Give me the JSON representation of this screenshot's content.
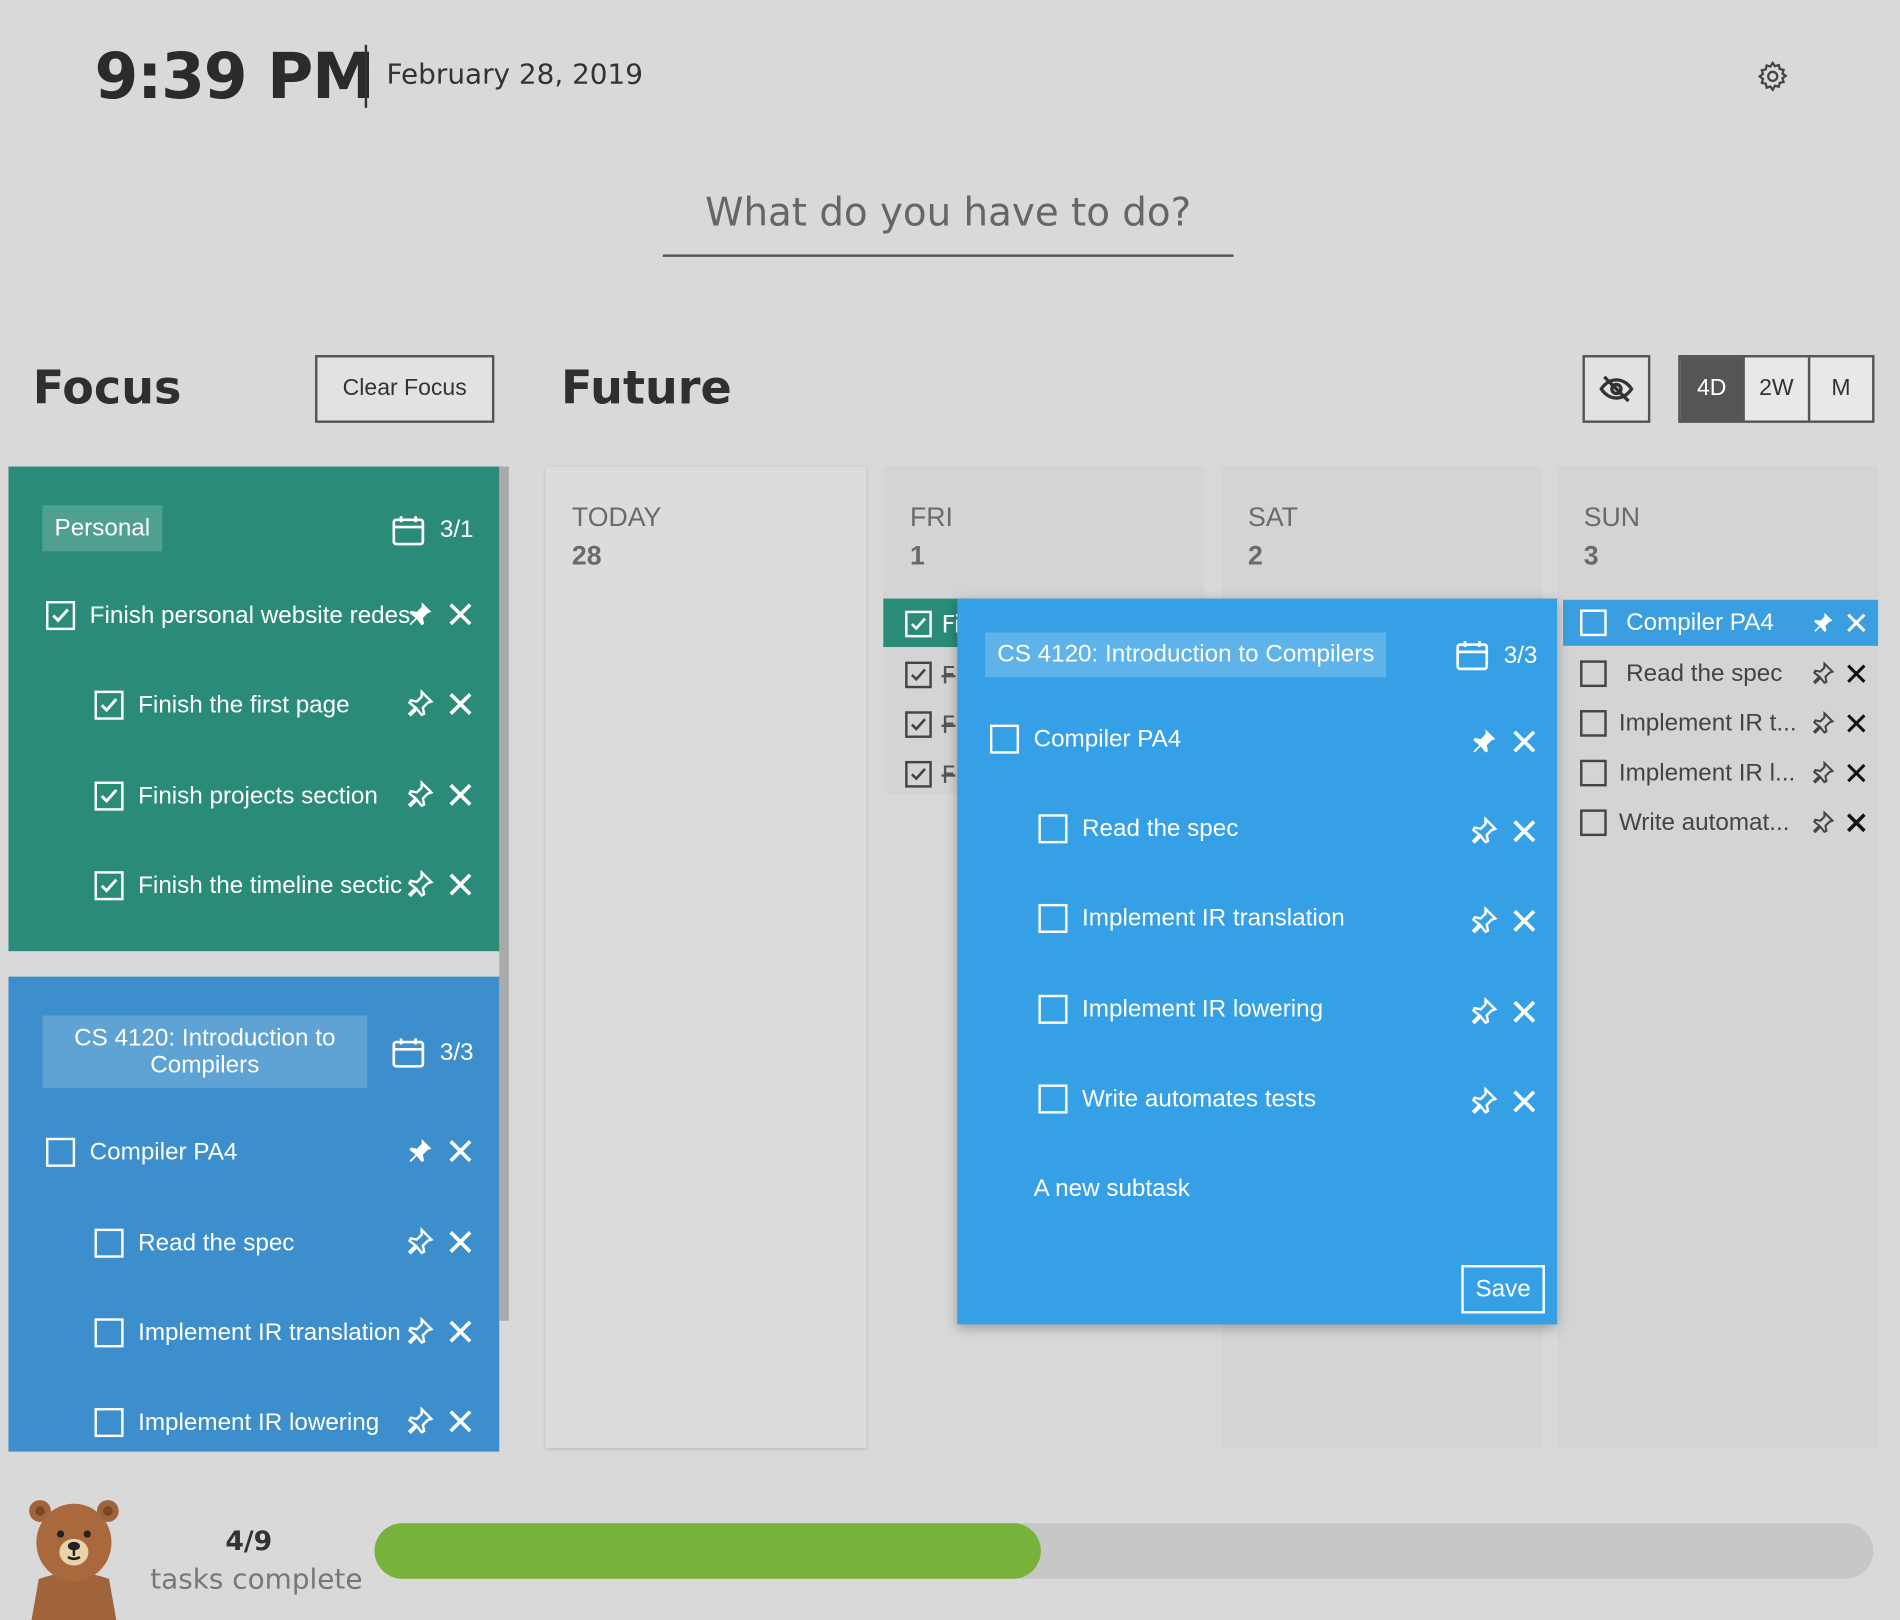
{
  "header": {
    "time": "9:39 PM",
    "date": "February 28, 2019",
    "settings_icon": "gear-icon"
  },
  "new_task": {
    "placeholder": "What do you have to do?"
  },
  "focus": {
    "title": "Focus",
    "clear_label": "Clear Focus",
    "cards": [
      {
        "tag": "Personal",
        "due": "3/1",
        "color": "#2a8c78",
        "tasks": [
          {
            "label": "Finish personal website redes",
            "checked": true,
            "pinned": true
          },
          {
            "label": "Finish the first page",
            "checked": true,
            "pinned": false
          },
          {
            "label": "Finish projects section",
            "checked": true,
            "pinned": false
          },
          {
            "label": "Finish the timeline sectic",
            "checked": true,
            "pinned": false
          }
        ]
      },
      {
        "tag": "CS 4120: Introduction to Compilers",
        "due": "3/3",
        "color": "#3c8fcc",
        "tasks": [
          {
            "label": "Compiler PA4",
            "checked": false,
            "pinned": true
          },
          {
            "label": "Read the spec",
            "checked": false,
            "pinned": false
          },
          {
            "label": "Implement IR translation",
            "checked": false,
            "pinned": false
          },
          {
            "label": "Implement IR lowering",
            "checked": false,
            "pinned": false
          }
        ]
      }
    ]
  },
  "future": {
    "title": "Future",
    "hide_icon": "eye-off-icon",
    "views": [
      "4D",
      "2W",
      "M"
    ],
    "active_view": "4D",
    "columns": [
      {
        "day": "TODAY",
        "num": "28"
      },
      {
        "day": "FRI",
        "num": "1",
        "peek": [
          "Fi",
          "F",
          "F",
          "F"
        ]
      },
      {
        "day": "SAT",
        "num": "2"
      },
      {
        "day": "SUN",
        "num": "3",
        "tasks": [
          "Compiler PA4",
          "Read the spec",
          "Implement IR t...",
          "Implement IR l...",
          "Write automat..."
        ]
      }
    ]
  },
  "editor": {
    "tag": "CS 4120: Introduction to Compilers",
    "due": "3/3",
    "task": "Compiler PA4",
    "subtasks": [
      "Read the spec",
      "Implement IR translation",
      "Implement IR lowering",
      "Write automates tests"
    ],
    "new_subtask": "A new subtask",
    "save_label": "Save",
    "color": "#36a0e6"
  },
  "progress": {
    "count": "4/9",
    "label": "tasks complete",
    "fraction": 0.4444,
    "color": "#77b23a"
  }
}
